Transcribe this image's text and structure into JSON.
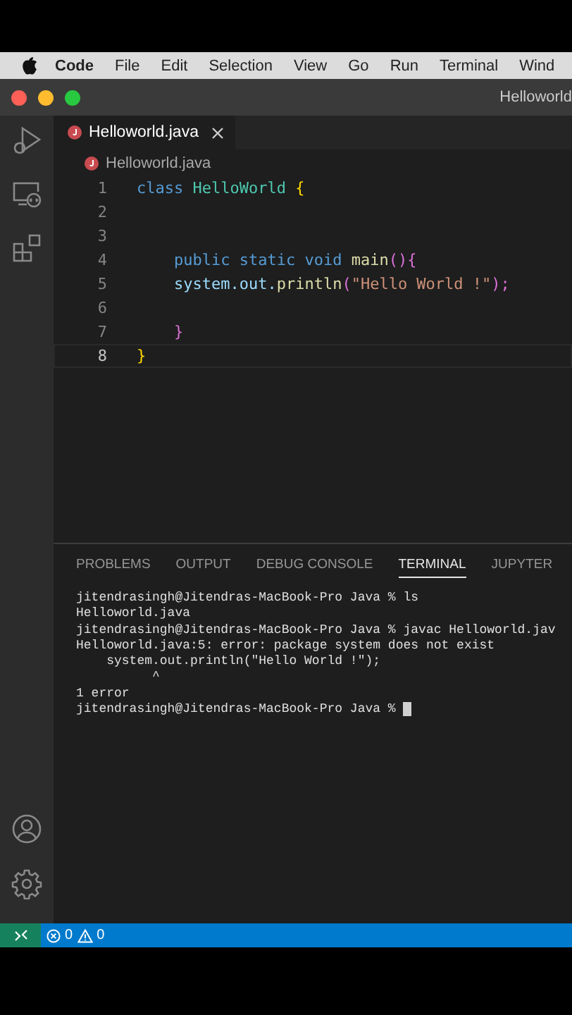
{
  "menubar": {
    "items": [
      {
        "label": "Code",
        "kind": "app"
      },
      {
        "label": "File",
        "kind": "menu"
      },
      {
        "label": "Edit",
        "kind": "menu"
      },
      {
        "label": "Selection",
        "kind": "menu"
      },
      {
        "label": "View",
        "kind": "menu"
      },
      {
        "label": "Go",
        "kind": "menu"
      },
      {
        "label": "Run",
        "kind": "menu"
      },
      {
        "label": "Terminal",
        "kind": "menu"
      },
      {
        "label": "Wind",
        "kind": "menu"
      }
    ]
  },
  "window": {
    "title": "Helloworld"
  },
  "tabs": [
    {
      "label": "Helloworld.java",
      "selected": true
    }
  ],
  "breadcrumb": [
    "Helloworld.java"
  ],
  "editor": {
    "lines": [
      {
        "number": "1",
        "current": false,
        "tokens": [
          {
            "text": "class",
            "kind": "keyword"
          },
          {
            "text": " HelloWorld",
            "kind": "type"
          },
          {
            "text": " {",
            "kind": "brace"
          }
        ]
      },
      {
        "number": "2",
        "current": false
      },
      {
        "number": "3",
        "current": false
      },
      {
        "number": "4",
        "current": false,
        "tokens": [
          {
            "text": "    public static void",
            "kind": "keyword"
          },
          {
            "text": " main",
            "kind": "function"
          },
          {
            "text": "(){",
            "kind": "paren"
          }
        ]
      },
      {
        "number": "5",
        "current": false,
        "tokens": [
          {
            "text": "    system.out.",
            "kind": "variable"
          },
          {
            "text": "println",
            "kind": "function"
          },
          {
            "text": "(",
            "kind": "paren"
          },
          {
            "text": "\"Hello World !\"",
            "kind": "string"
          },
          {
            "text": ");",
            "kind": "paren"
          }
        ]
      },
      {
        "number": "6",
        "current": false
      },
      {
        "number": "7",
        "current": false,
        "tokens": [
          {
            "text": "    }",
            "kind": "paren"
          }
        ]
      },
      {
        "number": "8",
        "current": true,
        "tokens": [
          {
            "text": "}",
            "kind": "brace"
          }
        ]
      }
    ]
  },
  "panel": {
    "tabs": [
      {
        "label": "PROBLEMS",
        "selected": false
      },
      {
        "label": "OUTPUT",
        "selected": false
      },
      {
        "label": "DEBUG CONSOLE",
        "selected": false
      },
      {
        "label": "TERMINAL",
        "selected": true
      },
      {
        "label": "JUPYTER",
        "selected": false
      }
    ],
    "terminal": [
      "jitendrasingh@Jitendras-MacBook-Pro Java % ls",
      "Helloworld.java",
      "jitendrasingh@Jitendras-MacBook-Pro Java % javac Helloworld.jav",
      "Helloworld.java:5: error: package system does not exist",
      "    system.out.println(\"Hello World !\");",
      "          ^",
      "1 error",
      "jitendrasingh@Jitendras-MacBook-Pro Java % "
    ]
  },
  "status_bar": {
    "errors": "0",
    "warnings": "0"
  }
}
